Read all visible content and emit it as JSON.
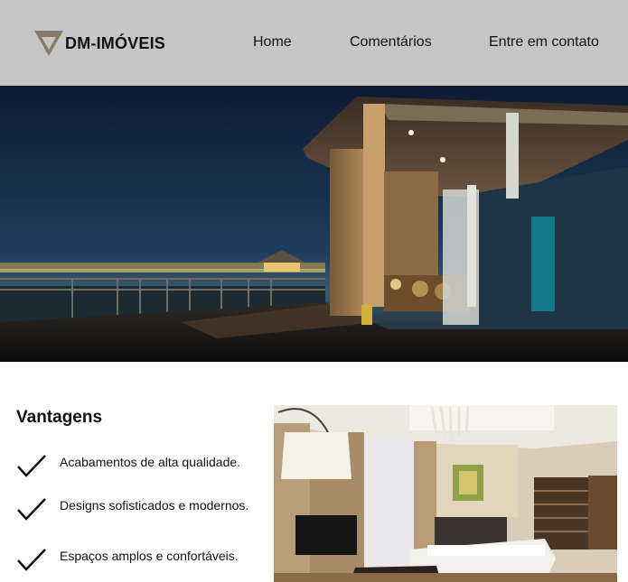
{
  "header": {
    "brand": "DM-IMÓVEIS",
    "nav": [
      "Home",
      "Comentários",
      "Entre em contato"
    ]
  },
  "hero": {
    "image": "night-house-waterfront-photo"
  },
  "advantages": {
    "title": "Vantagens",
    "items": [
      "Acabamentos de alta qualidade.",
      "Designs sofisticados e modernos.",
      "Espaços amplos e confortáveis."
    ]
  },
  "interior": {
    "image": "living-room-interior-photo"
  },
  "colors": {
    "header_bg": "#c6c6c6",
    "logo_accent": "#8a7a68"
  }
}
